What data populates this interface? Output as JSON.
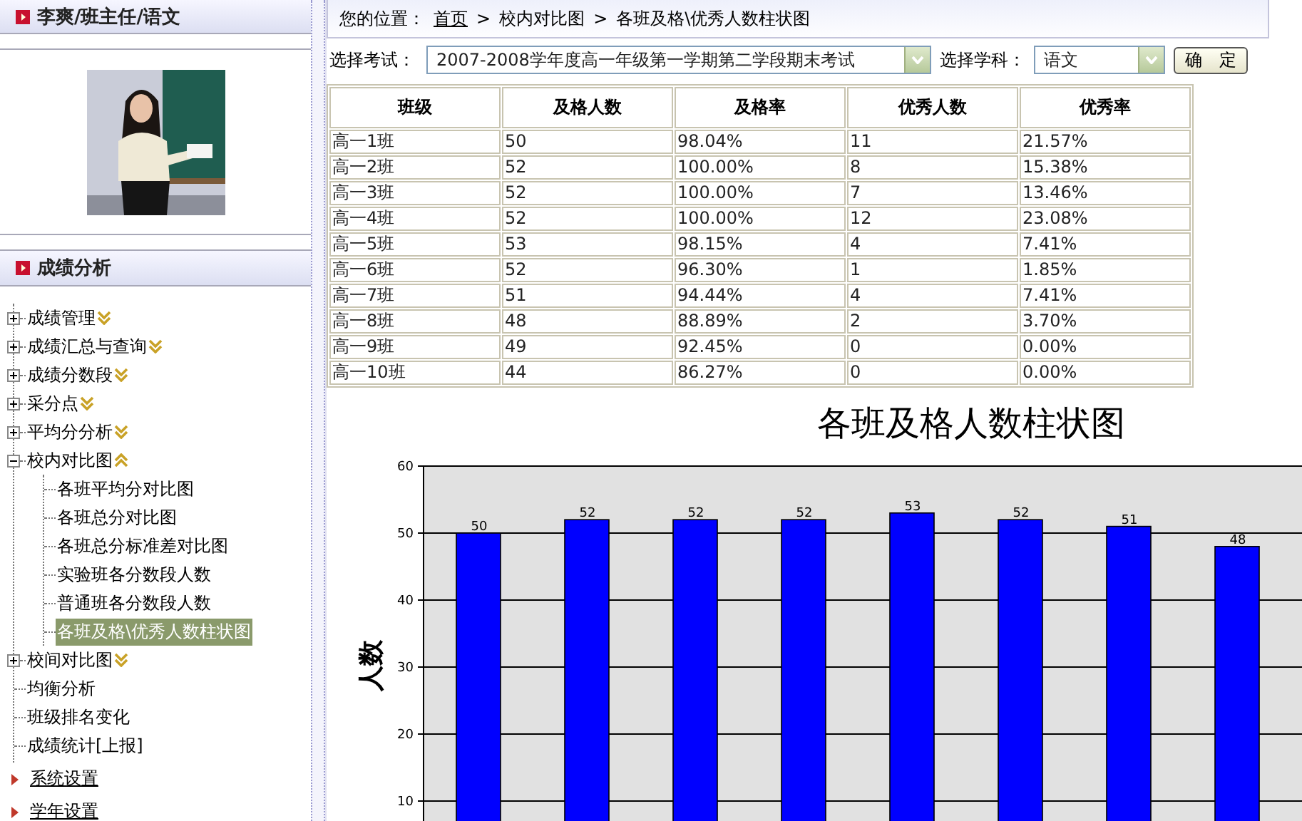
{
  "sidebar": {
    "user_header": "李爽/班主任/语文",
    "photo": {
      "kind": "picture"
    },
    "section_header": "成绩分析",
    "tree": [
      {
        "kind": "group",
        "label": "成绩管理",
        "expanded": false,
        "selected": false
      },
      {
        "kind": "group",
        "label": "成绩汇总与查询",
        "expanded": false,
        "selected": false
      },
      {
        "kind": "group",
        "label": "成绩分数段",
        "expanded": false,
        "selected": false
      },
      {
        "kind": "group",
        "label": "采分点",
        "expanded": false,
        "selected": false
      },
      {
        "kind": "group",
        "label": "平均分分析",
        "expanded": false,
        "selected": false
      },
      {
        "kind": "group",
        "label": "校内对比图",
        "expanded": true,
        "selected": false,
        "children": [
          {
            "label": "各班平均分对比图",
            "selected": false
          },
          {
            "label": "各班总分对比图",
            "selected": false
          },
          {
            "label": "各班总分标准差对比图",
            "selected": false
          },
          {
            "label": "实验班各分数段人数",
            "selected": false
          },
          {
            "label": "普通班各分数段人数",
            "selected": false
          },
          {
            "label": "各班及格\\优秀人数柱状图",
            "selected": true
          }
        ]
      },
      {
        "kind": "group",
        "label": "校间对比图",
        "expanded": false,
        "selected": false
      },
      {
        "kind": "leaf",
        "label": "均衡分析",
        "selected": false
      },
      {
        "kind": "leaf",
        "label": "班级排名变化",
        "selected": false
      },
      {
        "kind": "leaf",
        "label": "成绩统计[上报]",
        "selected": false
      }
    ],
    "links": [
      "系统设置",
      "学年设置"
    ]
  },
  "breadcrumb": {
    "prefix": "您的位置：",
    "items": [
      {
        "label": "首页",
        "kind": "link"
      },
      {
        "separator": ">",
        "label": "校内对比图",
        "kind": "text"
      },
      {
        "separator": ">",
        "label": "各班及格\\优秀人数柱状图",
        "kind": "text"
      }
    ]
  },
  "filters": {
    "exam_label": "选择考试：",
    "exam_value": "2007-2008学年度高一年级第一学期第二学段期末考试",
    "subject_label": "选择学科：",
    "subject_value": "语文",
    "confirm_button": "确　定"
  },
  "table": {
    "columns": [
      "班级",
      "及格人数",
      "及格率",
      "优秀人数",
      "优秀率"
    ],
    "rows": [
      [
        "高一1班",
        "50",
        "98.04%",
        "11",
        "21.57%"
      ],
      [
        "高一2班",
        "52",
        "100.00%",
        "8",
        "15.38%"
      ],
      [
        "高一3班",
        "52",
        "100.00%",
        "7",
        "13.46%"
      ],
      [
        "高一4班",
        "52",
        "100.00%",
        "12",
        "23.08%"
      ],
      [
        "高一5班",
        "53",
        "98.15%",
        "4",
        "7.41%"
      ],
      [
        "高一6班",
        "52",
        "96.30%",
        "1",
        "1.85%"
      ],
      [
        "高一7班",
        "51",
        "94.44%",
        "4",
        "7.41%"
      ],
      [
        "高一8班",
        "48",
        "88.89%",
        "2",
        "3.70%"
      ],
      [
        "高一9班",
        "49",
        "92.45%",
        "0",
        "0.00%"
      ],
      [
        "高一10班",
        "44",
        "86.27%",
        "0",
        "0.00%"
      ]
    ]
  },
  "chart": {
    "chart_data": {
      "type": "bar",
      "title": "各班及格人数柱状图",
      "ylabel": "人数",
      "values": [
        50,
        52,
        52,
        52,
        53,
        52,
        51,
        48
      ],
      "ylim": [
        0,
        60
      ],
      "yticks": [
        10,
        20,
        30,
        40,
        50,
        60
      ],
      "grid": true,
      "data_labels": true
    }
  }
}
